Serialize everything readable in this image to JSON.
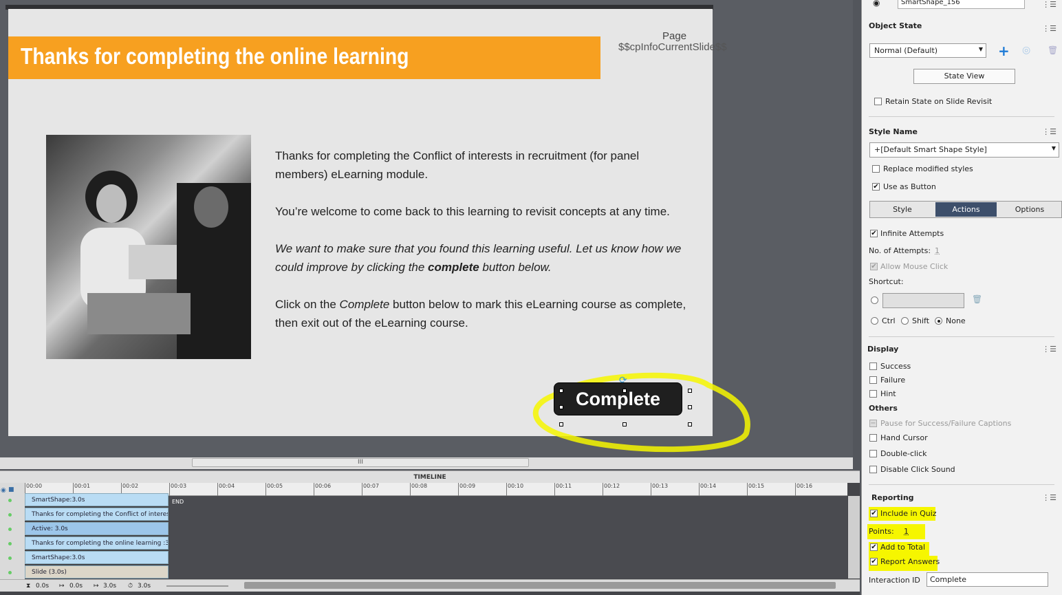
{
  "slide": {
    "title": "Thanks for completing the online learning",
    "page_label": "Page",
    "page_variable": "$$cpInfoCurrentSlide$$",
    "paragraphs": {
      "p1": "Thanks for completing the Conflict of interests in recruitment (for panel members) eLearning module.",
      "p2": "You’re welcome to come back to this learning to revisit concepts at any time.",
      "p3_a": "We want to make sure that you found this learning useful. Let us know how we could improve by clicking the ",
      "p3_b": "complete",
      "p3_c": " button below.",
      "p4_a": "Click on the ",
      "p4_b": "Complete",
      "p4_c": " button below to mark this eLearning course as complete, then exit out of the eLearning course."
    },
    "complete_button": "Complete"
  },
  "timeline": {
    "header": "TIMELINE",
    "ruler": [
      "00:00",
      "00:01",
      "00:02",
      "00:03",
      "00:04",
      "00:05",
      "00:06",
      "00:07",
      "00:08",
      "00:09",
      "00:10",
      "00:11",
      "00:12",
      "00:13",
      "00:14",
      "00:15",
      "00:16"
    ],
    "end_label": "END",
    "tracks": [
      "SmartShape:3.0s",
      "Thanks for completing the Conflict of interes...",
      "Active: 3.0s",
      "Thanks for completing the online learning :3...",
      "SmartShape:3.0s",
      "Slide (3.0s)"
    ],
    "footer": {
      "t1": "0.0s",
      "t2": "0.0s",
      "t3": "3.0s",
      "t4": "3.0s"
    },
    "scroll_grip": "III"
  },
  "panel": {
    "object_name": "SmartShape_156",
    "object_state_heading": "Object State",
    "state_select": "Normal (Default)",
    "state_view_button": "State View",
    "retain_state": "Retain State on Slide Revisit",
    "style_name_heading": "Style Name",
    "style_select": "+[Default Smart Shape Style]",
    "replace_modified": "Replace modified styles",
    "use_as_button": "Use as Button",
    "tabs": [
      "Style",
      "Actions",
      "Options"
    ],
    "infinite_attempts": "Infinite Attempts",
    "attempts_label": "No. of Attempts:",
    "attempts_value": "1",
    "allow_mouse_click": "Allow Mouse Click",
    "shortcut_label": "Shortcut:",
    "ctrl": "Ctrl",
    "shift": "Shift",
    "none": "None",
    "display_heading": "Display",
    "success": "Success",
    "failure": "Failure",
    "hint": "Hint",
    "others_heading": "Others",
    "pause_captions": "Pause for Success/Failure Captions",
    "hand_cursor": "Hand Cursor",
    "double_click": "Double-click",
    "disable_click_sound": "Disable Click Sound",
    "reporting_heading": "Reporting",
    "include_in_quiz": "Include in Quiz",
    "points_label": "Points:",
    "points_value": "1",
    "add_to_total": "Add to Total",
    "report_answers": "Report Answers",
    "interaction_id_label": "Interaction ID",
    "interaction_id_value": "Complete"
  },
  "colors": {
    "accent_orange": "#f7a020",
    "highlight_yellow": "#f6f600",
    "active_tab": "#3d4f6b"
  }
}
